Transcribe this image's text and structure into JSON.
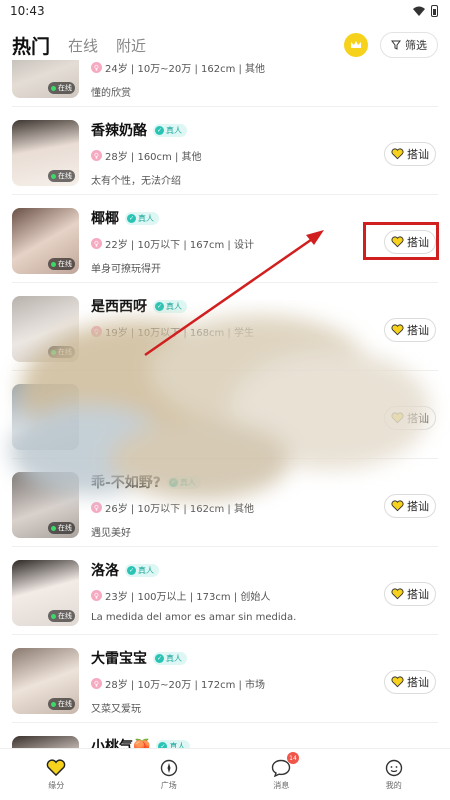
{
  "status_bar": {
    "time": "10:43"
  },
  "header": {
    "tabs": [
      {
        "label": "热门",
        "active": true
      },
      {
        "label": "在线",
        "active": false
      },
      {
        "label": "附近",
        "active": false
      }
    ],
    "filter_label": "筛选",
    "vip_icon": "crown-icon"
  },
  "common": {
    "real_badge": "真人",
    "greet_label": "搭讪",
    "online_label": "在线"
  },
  "users": [
    {
      "name": "",
      "info": "24岁 | 10万~20万 | 162cm | 其他",
      "bio": "懂的欣赏",
      "real": false,
      "greet": "搭讪"
    },
    {
      "name": "香辣奶酪",
      "info": "28岁 | 160cm | 其他",
      "bio": "太有个性，无法介绍",
      "real": true
    },
    {
      "name": "椰椰",
      "info": "22岁 | 10万以下 | 167cm | 设计",
      "bio": "单身可撩玩得开",
      "real": true
    },
    {
      "name": "是西西呀",
      "info": "19岁 | 10万以下 | 168cm | 学生",
      "bio": "",
      "real": true
    },
    {
      "name": "",
      "info": "",
      "bio": "",
      "real": false
    },
    {
      "name": "乖-不如野?",
      "info": "26岁 | 10万以下 | 162cm | 其他",
      "bio": "遇见美好",
      "real": true
    },
    {
      "name": "洛洛",
      "info": "23岁 | 100万以上 | 173cm | 创始人",
      "bio": "La medida del amor es amar sin medida.",
      "real": true
    },
    {
      "name": "大雷宝宝",
      "info": "28岁 | 10万~20万 | 172cm | 市场",
      "bio": "又菜又爱玩",
      "real": true
    },
    {
      "name": "小桃气🍑",
      "info": "",
      "bio": "",
      "real": true
    }
  ],
  "bottom_nav": [
    {
      "label": "缘分",
      "icon": "heart-icon",
      "active": true
    },
    {
      "label": "广场",
      "icon": "compass-icon",
      "active": false
    },
    {
      "label": "消息",
      "icon": "chat-icon",
      "active": false,
      "badge": "14"
    },
    {
      "label": "我的",
      "icon": "profile-icon",
      "active": false
    }
  ],
  "colors": {
    "accent": "#f6d21c",
    "real_badge": "#2ac3b4",
    "highlight": "#d11f1f",
    "online": "#3bd86a"
  }
}
